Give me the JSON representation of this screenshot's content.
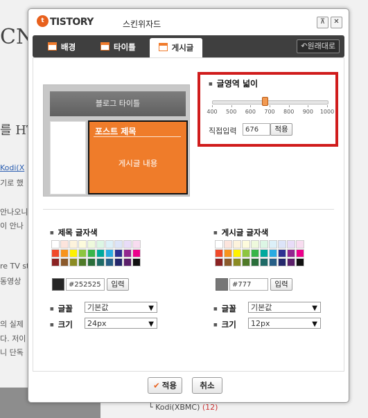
{
  "background": {
    "big_text_1": "CN",
    "big_text_2": "를 HT",
    "lines": [
      "Kodi(X",
      "기로 했",
      "안나오니",
      "이 안나",
      "re TV st",
      "동영상",
      "의 실제 ",
      "다. 저이",
      "니 단독"
    ],
    "kodi_label": "└ Kodi(XBMC)",
    "kodi_count": "(12)"
  },
  "dialog": {
    "logo_mark": "t",
    "logo_text": "TISTORY",
    "title": "스킨위자드",
    "pin_icon": "pin-icon",
    "close_icon": "close-icon",
    "pin_glyph": "⊼",
    "close_glyph": "✕"
  },
  "tabs": [
    {
      "label": "배경",
      "active": false
    },
    {
      "label": "타이틀",
      "active": false
    },
    {
      "label": "게시글",
      "active": true
    }
  ],
  "revert_label": "원래대로",
  "preview": {
    "blog_title": "블로그 타이틀",
    "post_title": "포스트 제목",
    "post_body": "게시글 내용"
  },
  "width_section": {
    "title": "글영역 넓이",
    "slider_value": 676,
    "slider_min": 400,
    "slider_max": 1000,
    "ticks": [
      "400",
      "500",
      "600",
      "700",
      "800",
      "900",
      "1000"
    ],
    "direct_label": "직접입력",
    "direct_value": "676",
    "apply_label": "적용"
  },
  "title_color": {
    "label": "제목 글자색",
    "value": "#252525",
    "preview_color": "#252525",
    "input_button": "입력"
  },
  "post_color": {
    "label": "게시글 글자색",
    "value": "#777",
    "preview_color": "#777777",
    "input_button": "입력"
  },
  "palette": [
    [
      "#ffffff",
      "#fce4dc",
      "#fdf3dc",
      "#fdfbdc",
      "#eef9dc",
      "#dcf6e4",
      "#dcf0f8",
      "#dce4f8",
      "#e8dcf8",
      "#f8dcf0"
    ],
    [
      "#f04a2a",
      "#f7941d",
      "#fff200",
      "#8dc63f",
      "#39b54a",
      "#00a99d",
      "#29abe2",
      "#2e3192",
      "#92278f",
      "#ec008c"
    ],
    [
      "#8b2323",
      "#8b5a2b",
      "#8b8b23",
      "#4f7a28",
      "#2a6e3a",
      "#1f6b67",
      "#275f87",
      "#24276b",
      "#5b1f6a",
      "#111111"
    ]
  ],
  "title_font": {
    "font_label": "글꼴",
    "font_value": "기본값",
    "size_label": "크기",
    "size_value": "24px"
  },
  "post_font": {
    "font_label": "글꼴",
    "font_value": "기본값",
    "size_label": "크기",
    "size_value": "12px"
  },
  "footer": {
    "apply_label": "적용",
    "cancel_label": "취소"
  }
}
